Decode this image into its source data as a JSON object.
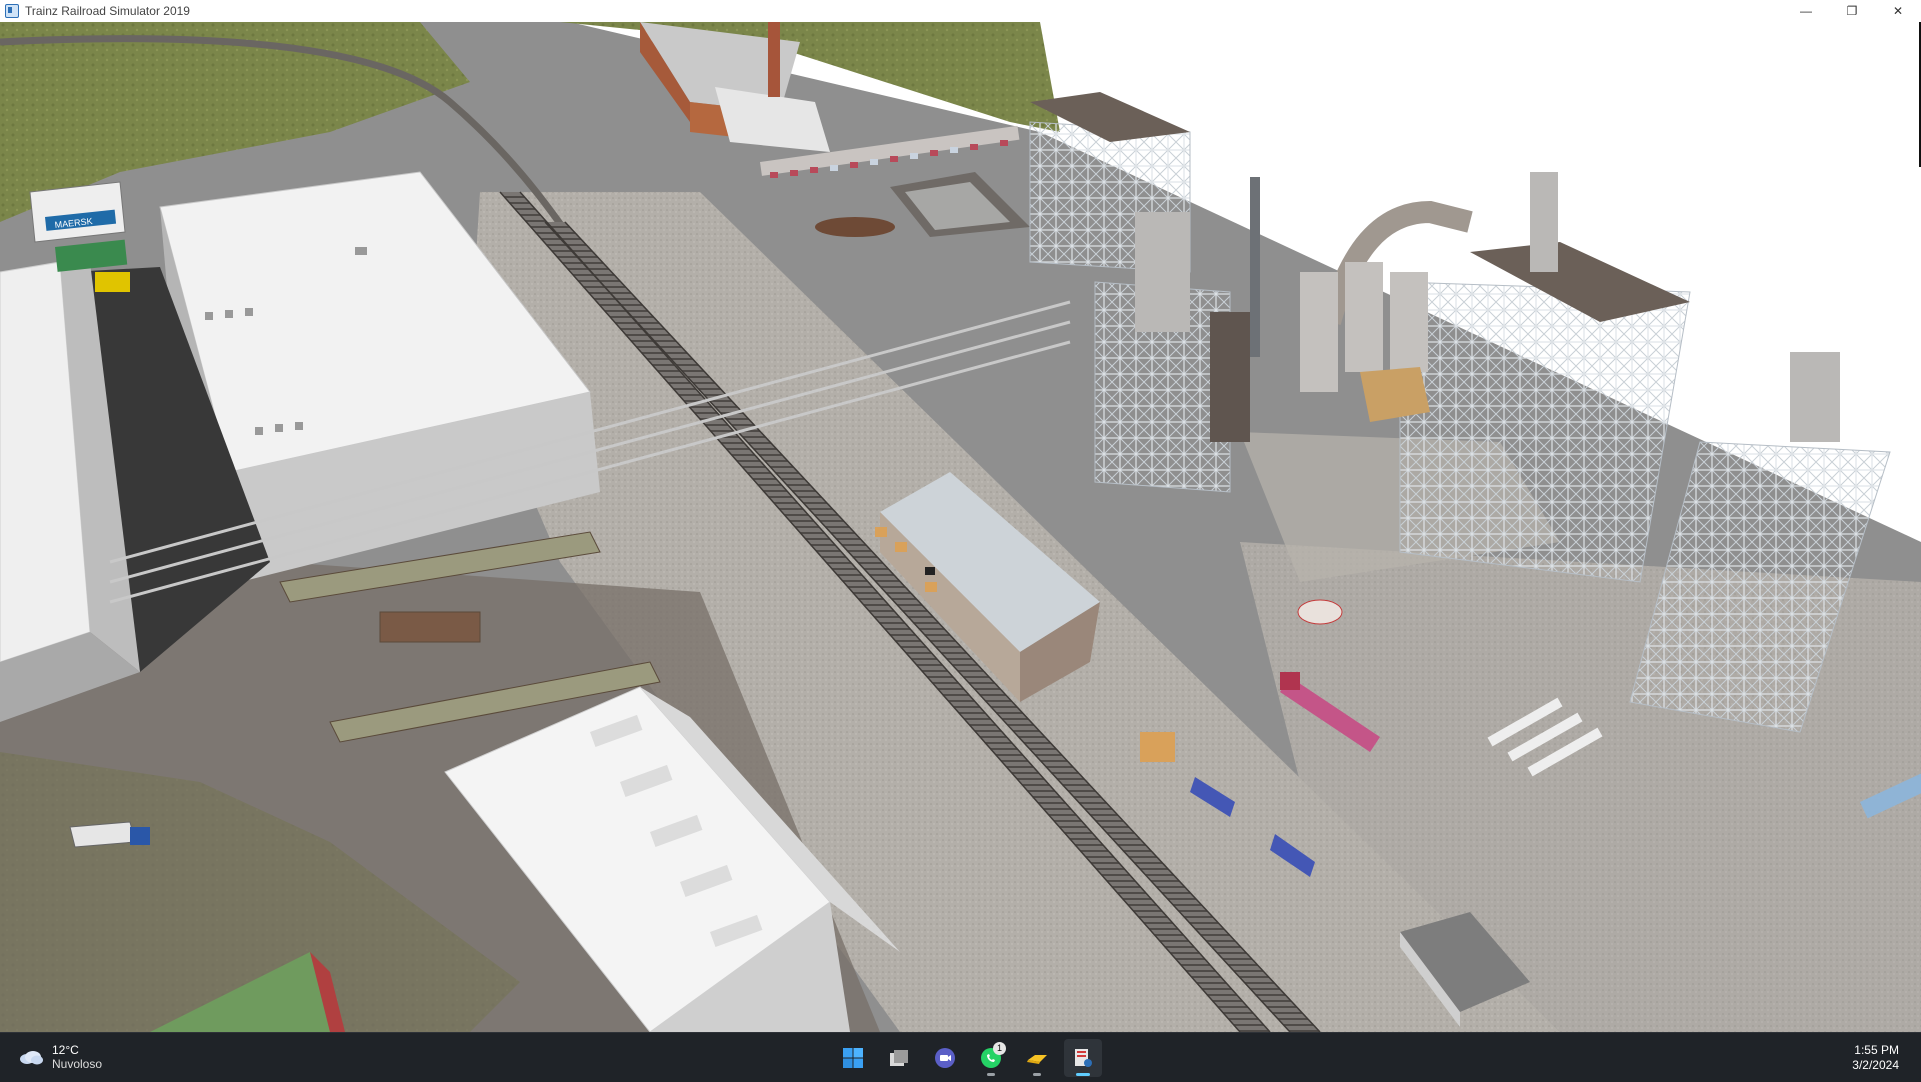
{
  "window": {
    "title": "Trainz Railroad Simulator 2019",
    "controls": {
      "minimize": "—",
      "restore": "❐",
      "close": "✕"
    }
  },
  "scene": {
    "sign_text": "MAERSK"
  },
  "taskbar": {
    "weather": {
      "temperature": "12°C",
      "condition": "Nuvoloso",
      "icon": "cloud-icon"
    },
    "apps": [
      {
        "name": "start-button",
        "icon": "windows-logo-icon"
      },
      {
        "name": "task-view",
        "icon": "task-view-icon"
      },
      {
        "name": "teams",
        "icon": "video-chat-icon"
      },
      {
        "name": "whatsapp",
        "icon": "whatsapp-icon",
        "badge": "1"
      },
      {
        "name": "file-explorer",
        "icon": "folder-icon"
      },
      {
        "name": "trainz",
        "icon": "trainz-app-icon"
      }
    ],
    "clock": {
      "time": "1:55 PM",
      "date": "3/2/2024"
    }
  },
  "colors": {
    "taskbar": "#1f2328",
    "accent": "#60cdff",
    "grass": "#7f8a4a",
    "concrete": "#8e8e8e",
    "gravel": "#b4b0aa"
  }
}
